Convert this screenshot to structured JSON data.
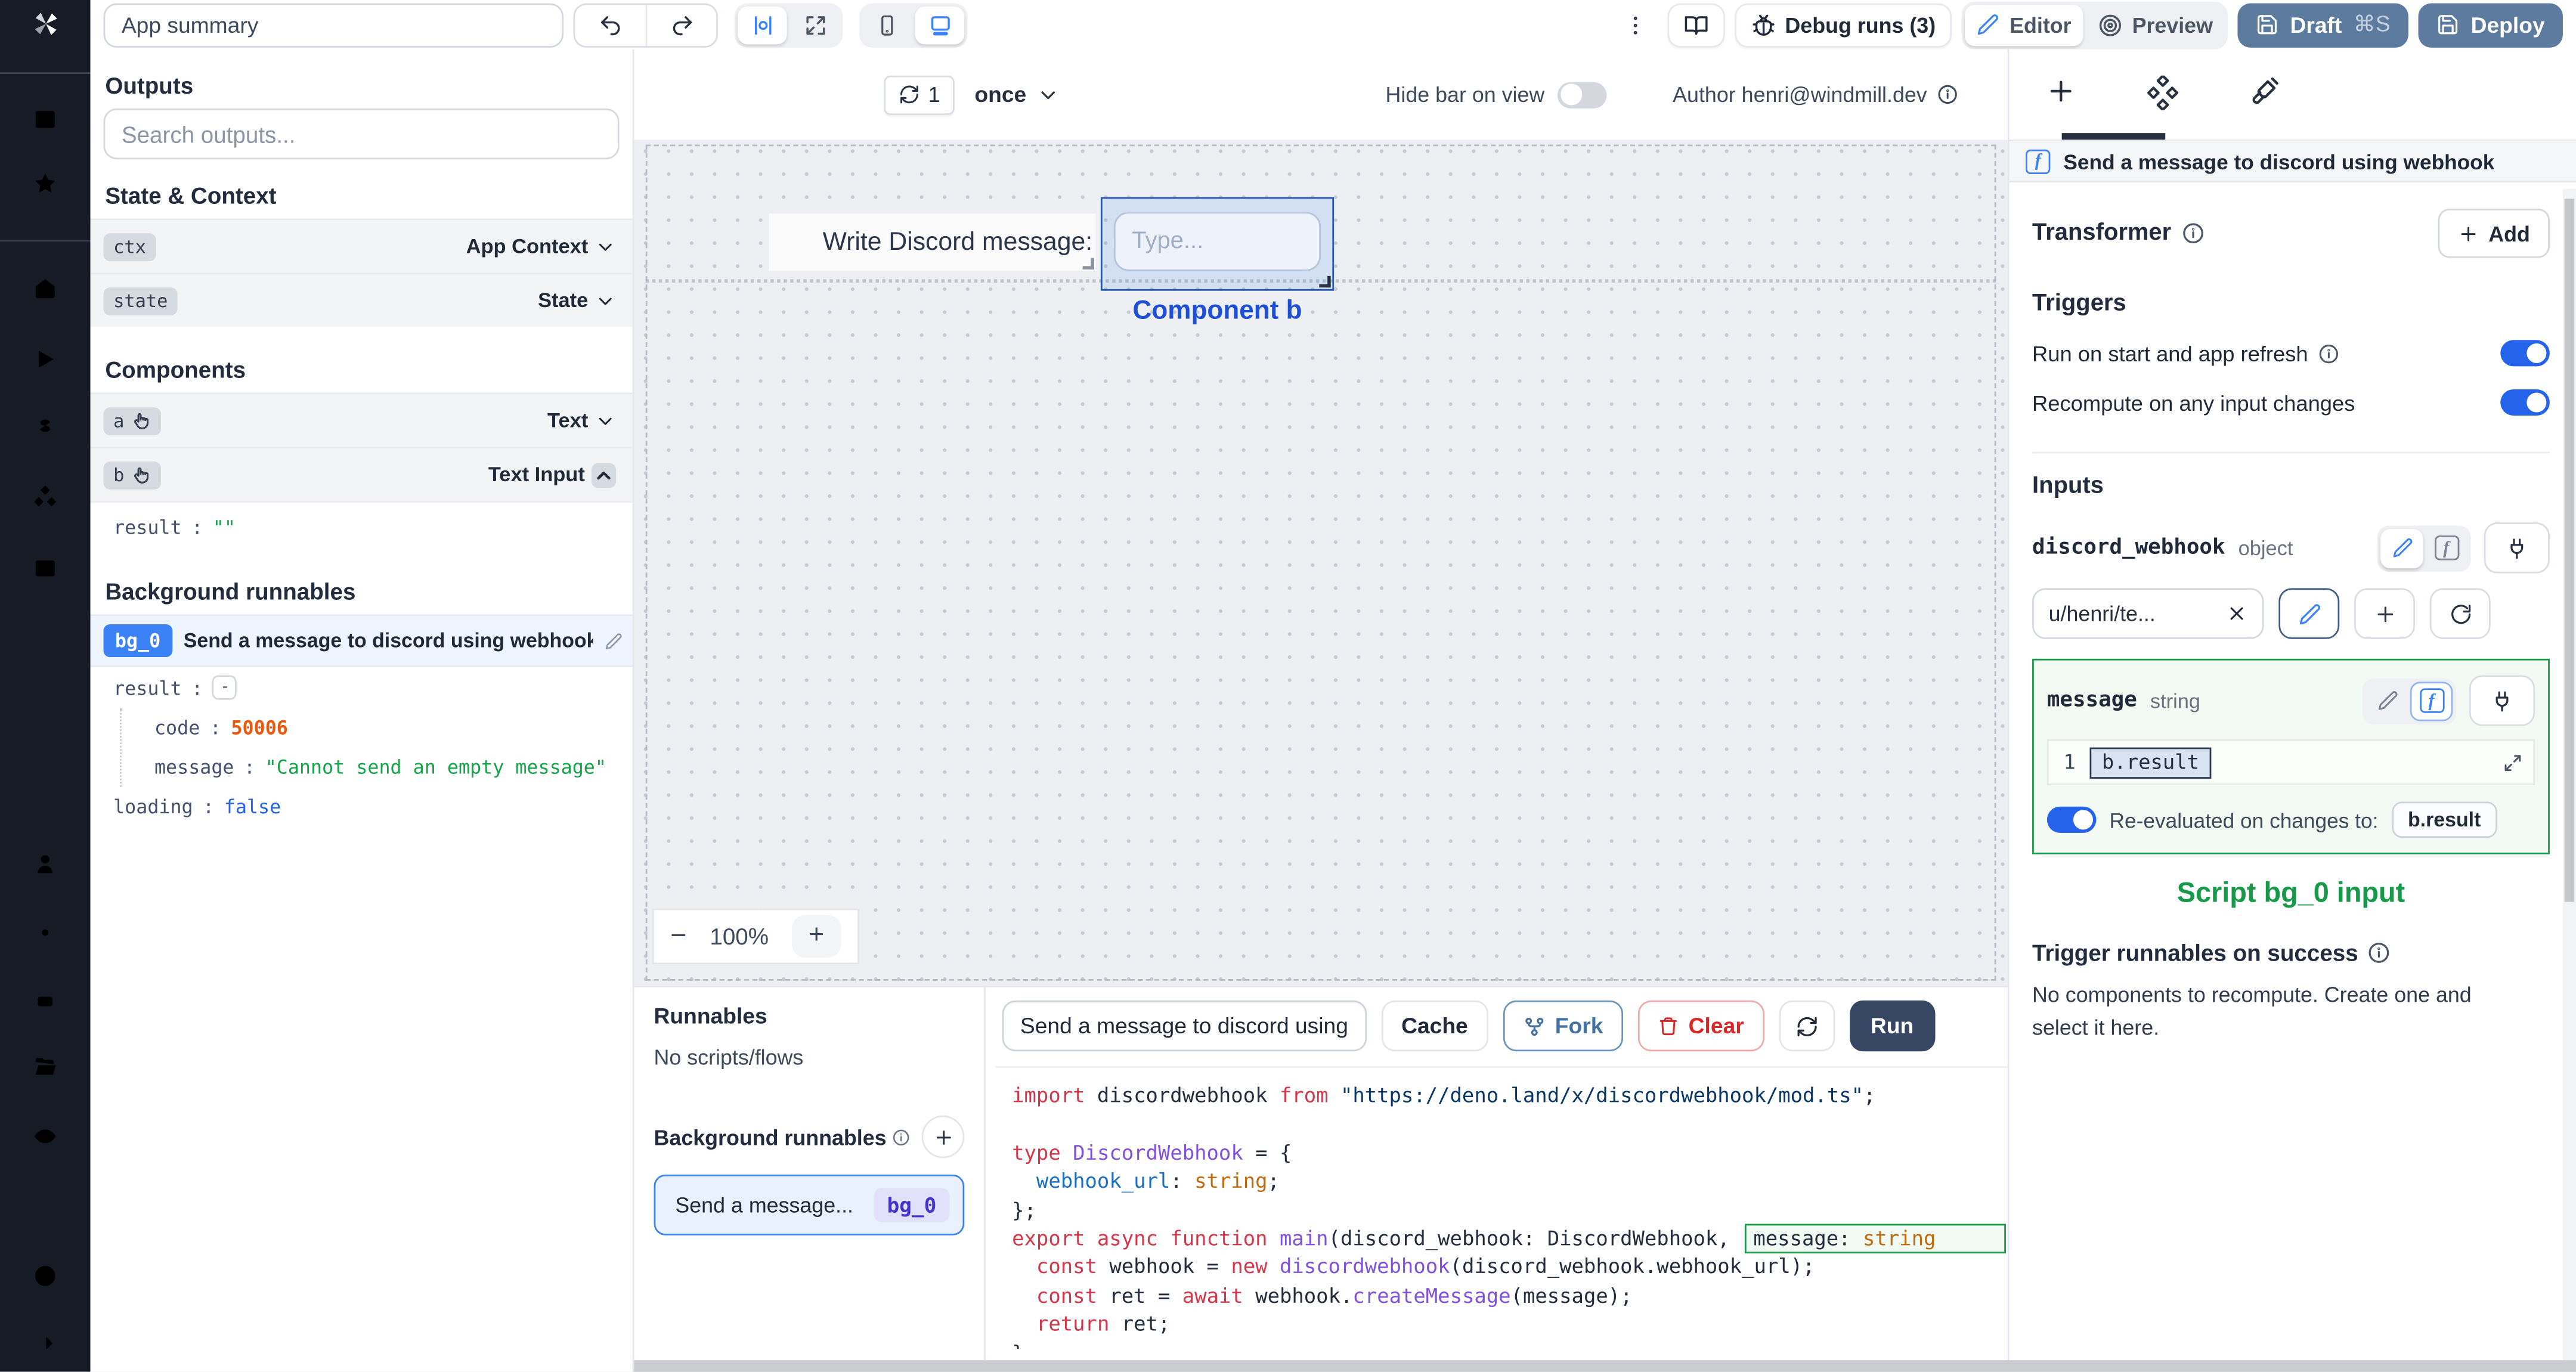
{
  "colors": {
    "accent_blue": "#3b82f6",
    "selection_blue": "#2457ad",
    "green": "#16a34a",
    "orange": "#ea580c",
    "value_blue": "#2563eb",
    "slate_button": "#5d7b9e",
    "rail_bg": "#171b25",
    "run_button": "#374763"
  },
  "icons": {
    "logo": "windmill-pinwheel",
    "undo": "curved-arrow-left",
    "redo": "curved-arrow-right",
    "component_outline": "|o|",
    "expand": "arrows-out",
    "mobile": "smartphone",
    "desktop": "monitor",
    "kebab": "vertical-dots",
    "docs": "open-book",
    "debug": "bug",
    "editor": "pencil",
    "preview": "eye",
    "save": "floppy-disk",
    "refresh": "circular-arrows",
    "chevron": "v",
    "info": "circle-i",
    "hand": "pointer-hand",
    "plug": "power-plug",
    "fx": "boxed-f",
    "fork": "git-fork",
    "trash": "trash-can",
    "copy": "clipboard-copy",
    "expand_code": "diagonal-arrows",
    "diamonds": "component-diamonds",
    "brush": "paintbrush"
  },
  "topbar": {
    "app_summary_placeholder": "App summary",
    "debug_runs": "Debug runs (3)",
    "editor": "Editor",
    "preview": "Preview",
    "draft": "Draft",
    "draft_shortcut": "⌘S",
    "deploy": "Deploy"
  },
  "left_panel": {
    "outputs_title": "Outputs",
    "search_placeholder": "Search outputs...",
    "state_context": {
      "title": "State & Context",
      "rows": [
        {
          "badge": "ctx",
          "type": "App Context"
        },
        {
          "badge": "state",
          "type": "State"
        }
      ]
    },
    "components": {
      "title": "Components",
      "row_a": {
        "badge": "a",
        "type": "Text"
      },
      "row_b": {
        "badge": "b",
        "type": "Text Input"
      },
      "b_result": {
        "key": "result",
        "colon": ":",
        "value": "\"\""
      }
    },
    "background_runnables": {
      "title": "Background runnables",
      "badge": "bg_0",
      "name": "Send a message to discord using webhook",
      "result": {
        "key": "result",
        "colon": ":",
        "collapse": "-"
      },
      "code": {
        "key": "code",
        "colon": ":",
        "value": "50006"
      },
      "message": {
        "key": "message",
        "colon": ":",
        "value": "\"Cannot send an empty message\""
      },
      "loading": {
        "key": "loading",
        "colon": ":",
        "value": "false"
      }
    }
  },
  "canvas": {
    "refresh_count": "1",
    "interval": "once",
    "hide_bar_label": "Hide bar on view",
    "author_label": "Author henri@windmill.dev",
    "component_a_text": "Write Discord message:",
    "component_b_placeholder": "Type...",
    "component_b_label": "Component b",
    "zoom": {
      "minus": "−",
      "level": "100%",
      "plus": "+"
    }
  },
  "runnables_panel": {
    "title": "Runnables",
    "empty": "No scripts/flows",
    "bg_title": "Background runnables",
    "item": {
      "name": "Send a message...",
      "badge": "bg_0"
    }
  },
  "code_panel": {
    "script_name": "Send a message to discord using",
    "cache": "Cache",
    "fork": "Fork",
    "clear": "Clear",
    "run": "Run",
    "lines": [
      [
        {
          "t": "import",
          "c": "kw"
        },
        {
          "t": " discordwebhook ",
          "c": "plain"
        },
        {
          "t": "from",
          "c": "kw"
        },
        {
          "t": " ",
          "c": "plain"
        },
        {
          "t": "\"https://deno.land/x/discordwebhook/mod.ts\"",
          "c": "str"
        },
        {
          "t": ";",
          "c": "plain"
        }
      ],
      [],
      [
        {
          "t": "type",
          "c": "kw"
        },
        {
          "t": " ",
          "c": "plain"
        },
        {
          "t": "DiscordWebhook",
          "c": "type"
        },
        {
          "t": " = {",
          "c": "plain"
        }
      ],
      [
        {
          "t": "  webhook_url",
          "c": "prop"
        },
        {
          "t": ": ",
          "c": "plain"
        },
        {
          "t": "string",
          "c": "orange"
        },
        {
          "t": ";",
          "c": "plain"
        }
      ],
      [
        {
          "t": "};",
          "c": "plain"
        }
      ],
      [
        {
          "t": "export",
          "c": "kw"
        },
        {
          "t": " ",
          "c": "plain"
        },
        {
          "t": "async",
          "c": "kw"
        },
        {
          "t": " ",
          "c": "plain"
        },
        {
          "t": "function",
          "c": "kw"
        },
        {
          "t": " ",
          "c": "plain"
        },
        {
          "t": "main",
          "c": "fn"
        },
        {
          "t": "(discord_webhook: DiscordWebhook, ",
          "c": "plain"
        },
        {
          "box": [
            {
              "t": "message: ",
              "c": "plain"
            },
            {
              "t": "string",
              "c": "orange"
            }
          ]
        }
      ],
      [
        {
          "t": "  ",
          "c": "plain"
        },
        {
          "t": "const",
          "c": "kw"
        },
        {
          "t": " webhook = ",
          "c": "plain"
        },
        {
          "t": "new",
          "c": "kw"
        },
        {
          "t": " ",
          "c": "plain"
        },
        {
          "t": "discordwebhook",
          "c": "fn"
        },
        {
          "t": "(discord_webhook.webhook_url);",
          "c": "plain"
        }
      ],
      [
        {
          "t": "  ",
          "c": "plain"
        },
        {
          "t": "const",
          "c": "kw"
        },
        {
          "t": " ret = ",
          "c": "plain"
        },
        {
          "t": "await",
          "c": "kw"
        },
        {
          "t": " webhook.",
          "c": "plain"
        },
        {
          "t": "createMessage",
          "c": "fn"
        },
        {
          "t": "(message);",
          "c": "plain"
        }
      ],
      [
        {
          "t": "  ",
          "c": "plain"
        },
        {
          "t": "return",
          "c": "kw"
        },
        {
          "t": " ret;",
          "c": "plain"
        }
      ],
      [
        {
          "t": "}",
          "c": "plain"
        }
      ]
    ]
  },
  "right_panel": {
    "header": "Send a message to discord using webhook",
    "transformer": {
      "label": "Transformer",
      "add": "Add"
    },
    "triggers": {
      "title": "Triggers",
      "run_on_start": "Run on start and app refresh",
      "recompute": "Recompute on any input changes"
    },
    "inputs": {
      "title": "Inputs",
      "discord_webhook": {
        "name": "discord_webhook",
        "type": "object",
        "value": "u/henri/te..."
      },
      "message": {
        "name": "message",
        "type": "string",
        "line_number": "1",
        "expr": "b.result",
        "reeval_label": "Re-evaluated on changes to:",
        "reeval_target": "b.result"
      }
    },
    "script_input_label": "Script bg_0 input",
    "on_success": {
      "title": "Trigger runnables on success",
      "body": "No components to recompute. Create one and select it here."
    }
  }
}
